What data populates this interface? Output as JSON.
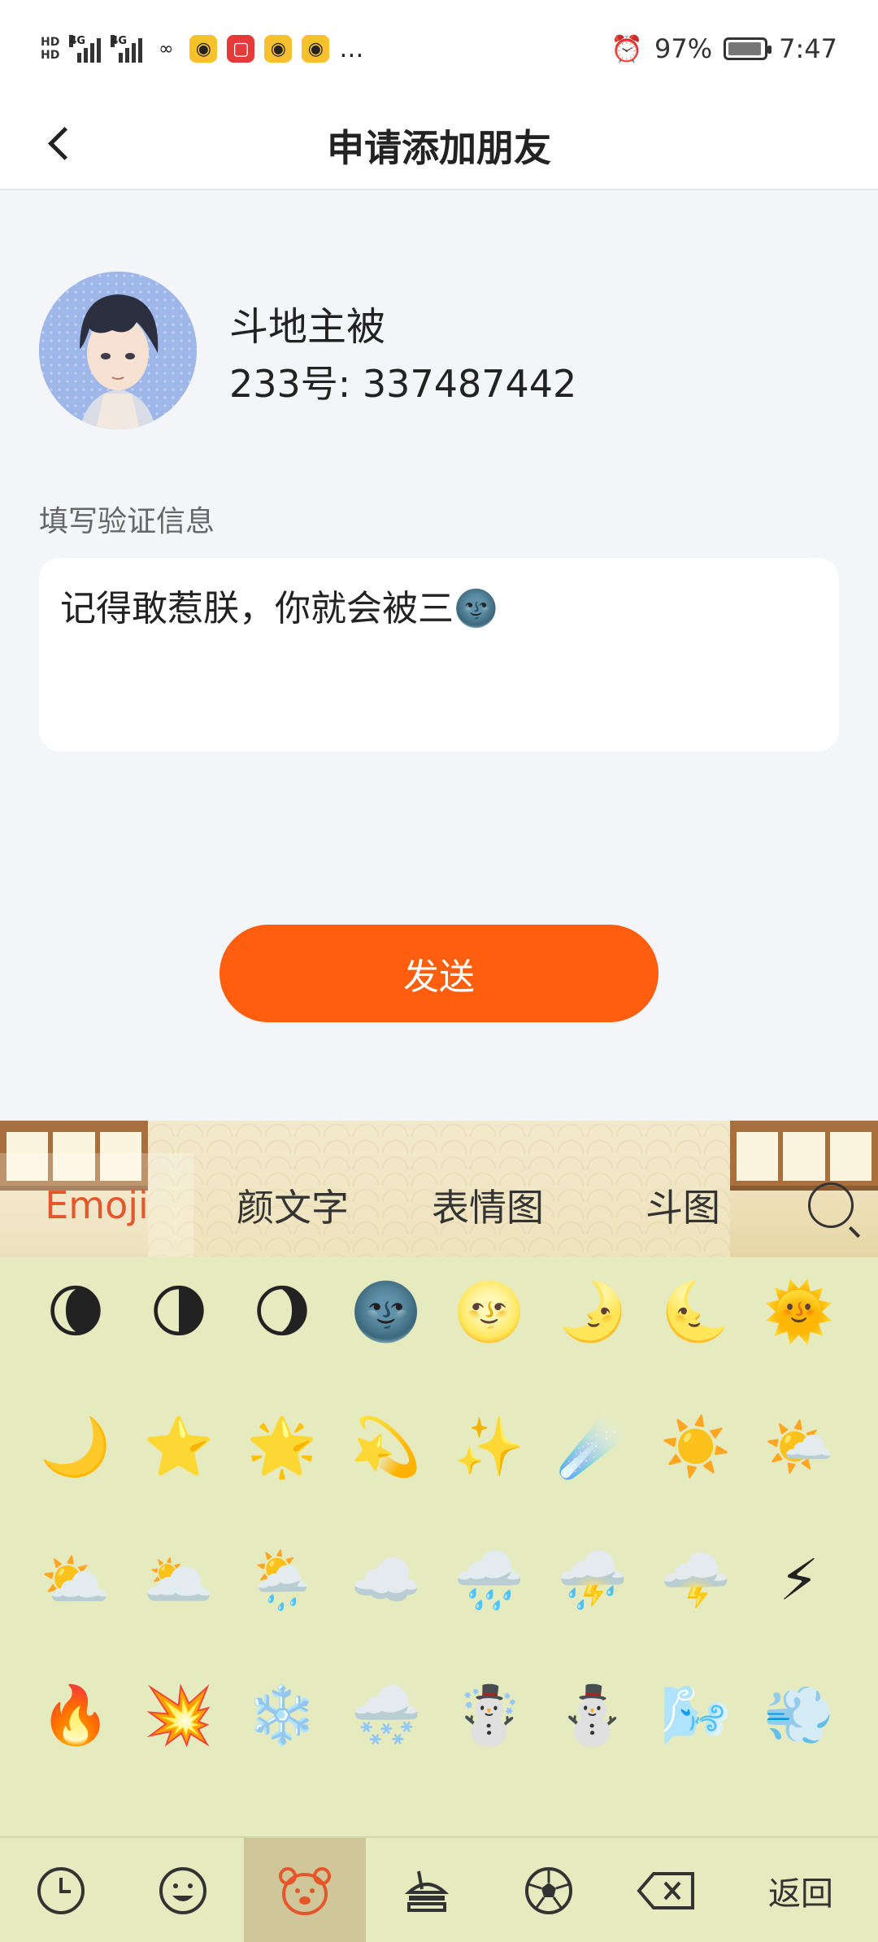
{
  "status_bar": {
    "left_icons": [
      "HD",
      "4G",
      "4G",
      "link-icon",
      "weibo-icon",
      "book-icon",
      "weibo-icon",
      "weibo-icon",
      "…"
    ],
    "battery": "97%",
    "time": "7:47"
  },
  "header": {
    "title": "申请添加朋友"
  },
  "profile": {
    "name": "斗地主被",
    "id_text": "233号: 337487442"
  },
  "verify": {
    "label": "填写验证信息",
    "message": "记得敢惹朕，你就会被三🌚"
  },
  "send_button": "发送",
  "keyboard": {
    "tabs": [
      "Emoji",
      "颜文字",
      "表情图",
      "斗图"
    ],
    "active_tab": "Emoji",
    "emoji_rows": [
      [
        "🌘",
        "🌗",
        "🌖",
        "🌚",
        "🌝",
        "🌛",
        "🌜",
        "🌞"
      ],
      [
        "🌙",
        "⭐",
        "🌟",
        "💫",
        "✨",
        "☄️",
        "☀️",
        "🌤️"
      ],
      [
        "⛅",
        "🌥️",
        "🌦️",
        "☁️",
        "🌧️",
        "⛈️",
        "🌩️",
        "⚡"
      ],
      [
        "🔥",
        "💥",
        "❄️",
        "🌨️",
        "☃️",
        "⛄",
        "🌬️",
        "💨"
      ]
    ],
    "bottom_icons": [
      "clock-icon",
      "smiley-icon",
      "bear-icon",
      "food-icon",
      "soccer-icon",
      "backspace-icon"
    ],
    "return_label": "返回"
  }
}
